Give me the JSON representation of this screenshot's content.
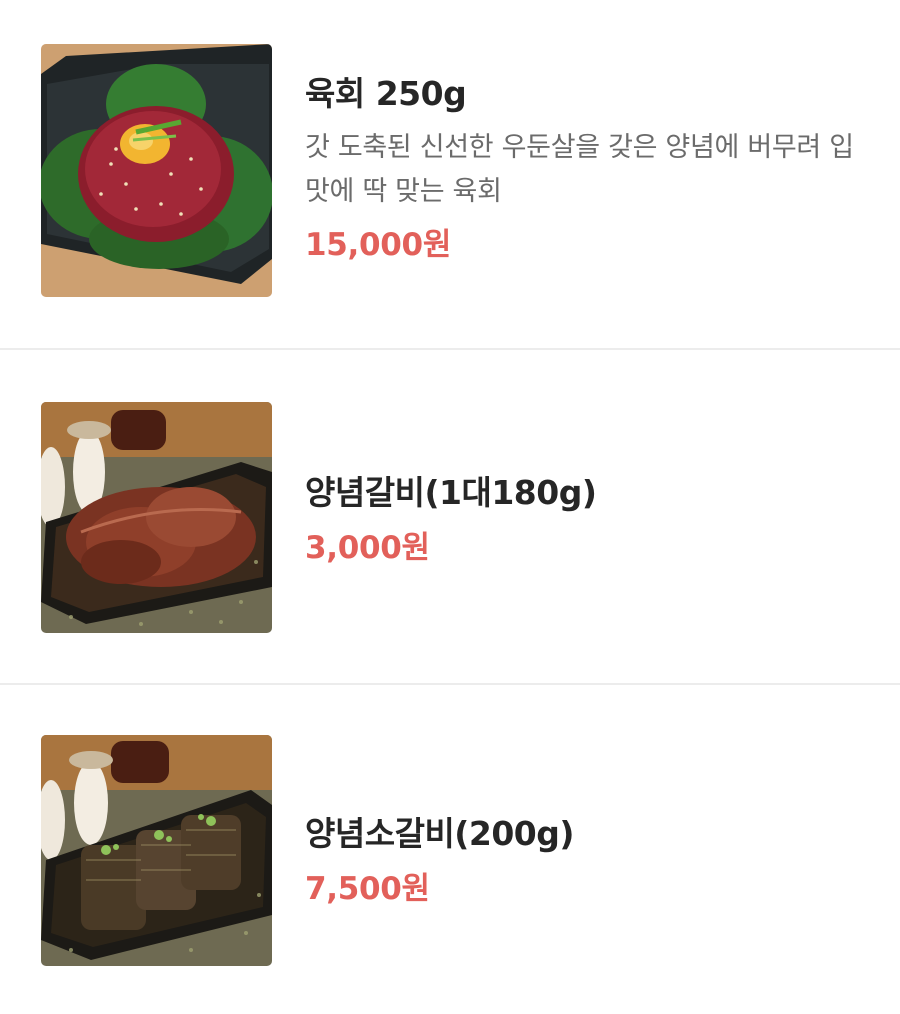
{
  "menu": {
    "items": [
      {
        "name": "육회 250g",
        "description": "갓 도축된 신선한 우둔살을 갖은 양념에 버무려 입맛에 딱 맞는 육회",
        "price": "15,000원",
        "image_icon": "yukhoe-photo"
      },
      {
        "name": "양념갈비(1대180g)",
        "price": "3,000원",
        "image_icon": "marinated-galbi-photo"
      },
      {
        "name": "양념소갈비(200g)",
        "price": "7,500원",
        "image_icon": "marinated-beef-galbi-photo"
      }
    ]
  },
  "colors": {
    "price": "#e2605a",
    "name": "#262626",
    "description": "#6b6b6b",
    "divider": "#ececec"
  }
}
